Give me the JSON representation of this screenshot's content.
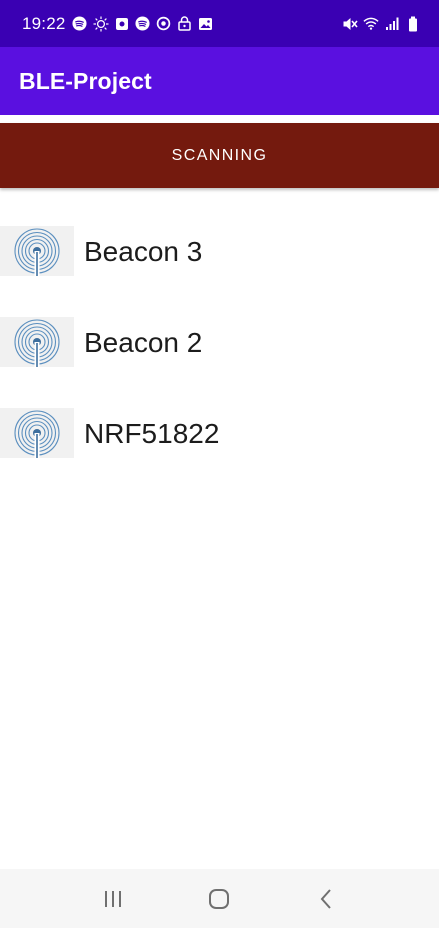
{
  "status_bar": {
    "time": "19:22",
    "left_icons": [
      "spotify-icon",
      "sun-settings-icon",
      "square-notification-icon",
      "spotify-icon",
      "sync-icon",
      "lock-icon",
      "image-icon"
    ],
    "right_icons": [
      "mute-icon",
      "wifi-icon",
      "signal-icon",
      "battery-icon"
    ]
  },
  "app_bar": {
    "title": "BLE-Project"
  },
  "scan_button": {
    "label": "SCANNING",
    "color": "#741a0e"
  },
  "devices": [
    {
      "name": "Beacon 3",
      "icon": "beacon-signal-icon"
    },
    {
      "name": "Beacon 2",
      "icon": "beacon-signal-icon"
    },
    {
      "name": "NRF51822",
      "icon": "beacon-signal-icon"
    }
  ],
  "nav_bar": {
    "buttons": [
      "recents-icon",
      "home-icon",
      "back-icon"
    ]
  },
  "colors": {
    "status_bar": "#3a00b3",
    "app_bar": "#5a10e0",
    "scan_button": "#741a0e"
  }
}
